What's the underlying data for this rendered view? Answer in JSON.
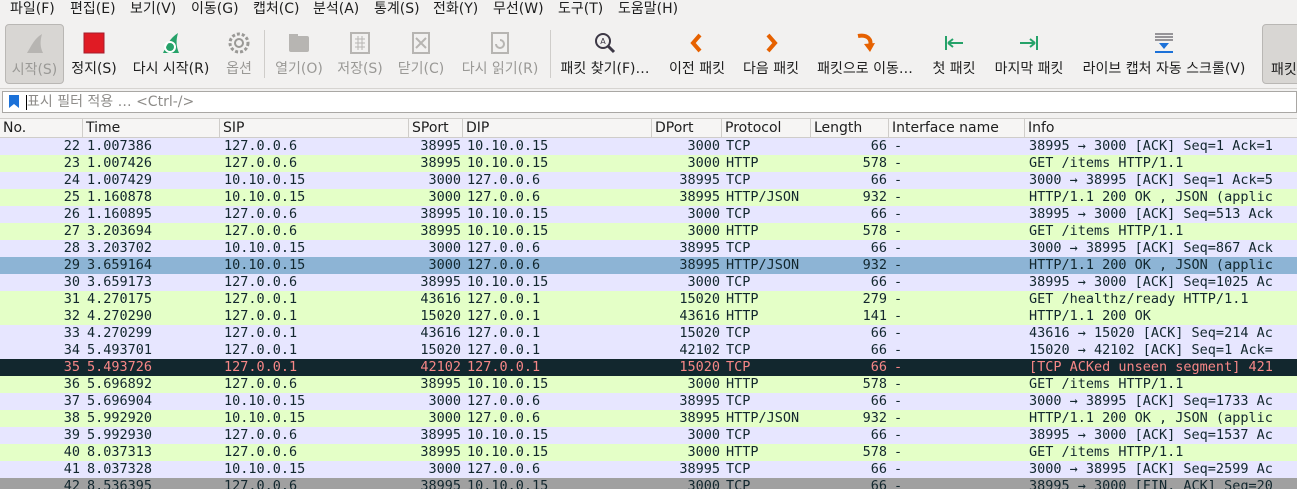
{
  "menu": [
    "파일(F)",
    "편집(E)",
    "보기(V)",
    "이동(G)",
    "캡처(C)",
    "분석(A)",
    "통계(S)",
    "전화(Y)",
    "무선(W)",
    "도구(T)",
    "도움말(H)"
  ],
  "toolbar": {
    "start": "시작(S)",
    "stop": "정지(S)",
    "restart": "다시 시작(R)",
    "options": "옵션",
    "open": "열기(O)",
    "save": "저장(S)",
    "close": "닫기(C)",
    "reload": "다시 읽기(R)",
    "find": "패킷 찾기(F)…",
    "prev": "이전 패킷",
    "next": "다음 패킷",
    "goto": "패킷으로 이동…",
    "first": "첫 패킷",
    "last": "마지막 패킷",
    "autoscroll": "라이브 캡처 자동 스크롤(V)",
    "more": "패킷"
  },
  "filter": {
    "placeholder": "표시 필터 적용 … <Ctrl-/>"
  },
  "columns": [
    "No.",
    "Time",
    "SIP",
    "SPort",
    "DIP",
    "DPort",
    "Protocol",
    "Length",
    "Interface name",
    "Info"
  ],
  "colors": {
    "ack_row": "#e7e6ff",
    "http_row": "#e4ffc7",
    "selected": "#8db4d5",
    "bad_bg": "#12272e",
    "bad_fg": "#f78787"
  },
  "packets": [
    {
      "no": "22",
      "time": "1.007386",
      "sip": "127.0.0.6",
      "sport": "38995",
      "dip": "10.10.0.15",
      "dport": "3000",
      "proto": "TCP",
      "len": "66",
      "iface": "-",
      "info": "38995 → 3000 [ACK] Seq=1 Ack=1",
      "kind": "ack"
    },
    {
      "no": "23",
      "time": "1.007426",
      "sip": "127.0.0.6",
      "sport": "38995",
      "dip": "10.10.0.15",
      "dport": "3000",
      "proto": "HTTP",
      "len": "578",
      "iface": "-",
      "info": "GET /items HTTP/1.1",
      "kind": "http"
    },
    {
      "no": "24",
      "time": "1.007429",
      "sip": "10.10.0.15",
      "sport": "3000",
      "dip": "127.0.0.6",
      "dport": "38995",
      "proto": "TCP",
      "len": "66",
      "iface": "-",
      "info": "3000 → 38995 [ACK] Seq=1 Ack=5",
      "kind": "ack"
    },
    {
      "no": "25",
      "time": "1.160878",
      "sip": "10.10.0.15",
      "sport": "3000",
      "dip": "127.0.0.6",
      "dport": "38995",
      "proto": "HTTP/JSON",
      "len": "932",
      "iface": "-",
      "info": "HTTP/1.1 200 OK , JSON (applic",
      "kind": "http"
    },
    {
      "no": "26",
      "time": "1.160895",
      "sip": "127.0.0.6",
      "sport": "38995",
      "dip": "10.10.0.15",
      "dport": "3000",
      "proto": "TCP",
      "len": "66",
      "iface": "-",
      "info": "38995 → 3000 [ACK] Seq=513 Ack",
      "kind": "ack"
    },
    {
      "no": "27",
      "time": "3.203694",
      "sip": "127.0.0.6",
      "sport": "38995",
      "dip": "10.10.0.15",
      "dport": "3000",
      "proto": "HTTP",
      "len": "578",
      "iface": "-",
      "info": "GET /items HTTP/1.1",
      "kind": "http"
    },
    {
      "no": "28",
      "time": "3.203702",
      "sip": "10.10.0.15",
      "sport": "3000",
      "dip": "127.0.0.6",
      "dport": "38995",
      "proto": "TCP",
      "len": "66",
      "iface": "-",
      "info": "3000 → 38995 [ACK] Seq=867 Ack",
      "kind": "ack"
    },
    {
      "no": "29",
      "time": "3.659164",
      "sip": "10.10.0.15",
      "sport": "3000",
      "dip": "127.0.0.6",
      "dport": "38995",
      "proto": "HTTP/JSON",
      "len": "932",
      "iface": "-",
      "info": "HTTP/1.1 200 OK , JSON (applic",
      "kind": "selected"
    },
    {
      "no": "30",
      "time": "3.659173",
      "sip": "127.0.0.6",
      "sport": "38995",
      "dip": "10.10.0.15",
      "dport": "3000",
      "proto": "TCP",
      "len": "66",
      "iface": "-",
      "info": "38995 → 3000 [ACK] Seq=1025 Ac",
      "kind": "ack"
    },
    {
      "no": "31",
      "time": "4.270175",
      "sip": "127.0.0.1",
      "sport": "43616",
      "dip": "127.0.0.1",
      "dport": "15020",
      "proto": "HTTP",
      "len": "279",
      "iface": "-",
      "info": "GET /healthz/ready HTTP/1.1",
      "kind": "http"
    },
    {
      "no": "32",
      "time": "4.270290",
      "sip": "127.0.0.1",
      "sport": "15020",
      "dip": "127.0.0.1",
      "dport": "43616",
      "proto": "HTTP",
      "len": "141",
      "iface": "-",
      "info": "HTTP/1.1 200 OK",
      "kind": "http"
    },
    {
      "no": "33",
      "time": "4.270299",
      "sip": "127.0.0.1",
      "sport": "43616",
      "dip": "127.0.0.1",
      "dport": "15020",
      "proto": "TCP",
      "len": "66",
      "iface": "-",
      "info": "43616 → 15020 [ACK] Seq=214 Ac",
      "kind": "ack"
    },
    {
      "no": "34",
      "time": "5.493701",
      "sip": "127.0.0.1",
      "sport": "15020",
      "dip": "127.0.0.1",
      "dport": "42102",
      "proto": "TCP",
      "len": "66",
      "iface": "-",
      "info": "15020 → 42102 [ACK] Seq=1 Ack=",
      "kind": "ack"
    },
    {
      "no": "35",
      "time": "5.493726",
      "sip": "127.0.0.1",
      "sport": "42102",
      "dip": "127.0.0.1",
      "dport": "15020",
      "proto": "TCP",
      "len": "66",
      "iface": "-",
      "info": "[TCP ACKed unseen segment] 421",
      "kind": "bad"
    },
    {
      "no": "36",
      "time": "5.696892",
      "sip": "127.0.0.6",
      "sport": "38995",
      "dip": "10.10.0.15",
      "dport": "3000",
      "proto": "HTTP",
      "len": "578",
      "iface": "-",
      "info": "GET /items HTTP/1.1",
      "kind": "http"
    },
    {
      "no": "37",
      "time": "5.696904",
      "sip": "10.10.0.15",
      "sport": "3000",
      "dip": "127.0.0.6",
      "dport": "38995",
      "proto": "TCP",
      "len": "66",
      "iface": "-",
      "info": "3000 → 38995 [ACK] Seq=1733 Ac",
      "kind": "ack"
    },
    {
      "no": "38",
      "time": "5.992920",
      "sip": "10.10.0.15",
      "sport": "3000",
      "dip": "127.0.0.6",
      "dport": "38995",
      "proto": "HTTP/JSON",
      "len": "932",
      "iface": "-",
      "info": "HTTP/1.1 200 OK , JSON (applic",
      "kind": "http"
    },
    {
      "no": "39",
      "time": "5.992930",
      "sip": "127.0.0.6",
      "sport": "38995",
      "dip": "10.10.0.15",
      "dport": "3000",
      "proto": "TCP",
      "len": "66",
      "iface": "-",
      "info": "38995 → 3000 [ACK] Seq=1537 Ac",
      "kind": "ack"
    },
    {
      "no": "40",
      "time": "8.037313",
      "sip": "127.0.0.6",
      "sport": "38995",
      "dip": "10.10.0.15",
      "dport": "3000",
      "proto": "HTTP",
      "len": "578",
      "iface": "-",
      "info": "GET /items HTTP/1.1",
      "kind": "http"
    },
    {
      "no": "41",
      "time": "8.037328",
      "sip": "10.10.0.15",
      "sport": "3000",
      "dip": "127.0.0.6",
      "dport": "38995",
      "proto": "TCP",
      "len": "66",
      "iface": "-",
      "info": "3000 → 38995 [ACK] Seq=2599 Ac",
      "kind": "ack"
    },
    {
      "no": "42",
      "time": "8.536395",
      "sip": "127.0.0.6",
      "sport": "38995",
      "dip": "10.10.0.15",
      "dport": "3000",
      "proto": "TCP",
      "len": "66",
      "iface": "-",
      "info": "38995 → 3000 [FIN, ACK] Seq=20",
      "kind": "fin"
    }
  ]
}
